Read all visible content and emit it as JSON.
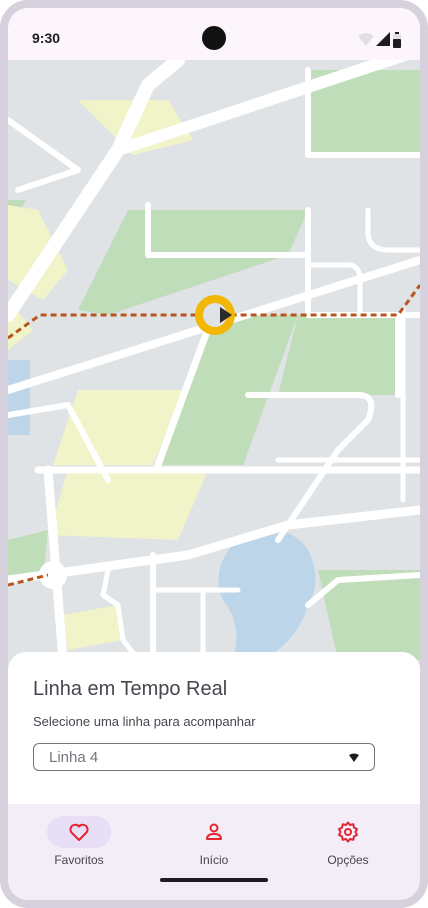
{
  "status_bar": {
    "time": "9:30",
    "icons": [
      "wifi-icon",
      "signal-icon",
      "battery-icon"
    ]
  },
  "map": {
    "route_color": "#b8541c",
    "bus_marker_color": "#f2b705",
    "park_color": "#bfddb8",
    "zone_color": "#f1f3c8",
    "water_color": "#bdd5e8"
  },
  "sheet": {
    "title": "Linha em Tempo Real",
    "subtitle": "Selecione uma linha para acompanhar",
    "select": {
      "value": "Linha 4"
    }
  },
  "nav": {
    "items": [
      {
        "label": "Favoritos",
        "icon": "heart-icon",
        "active": true
      },
      {
        "label": "Início",
        "icon": "person-icon",
        "active": false
      },
      {
        "label": "Opções",
        "icon": "gear-icon",
        "active": false
      }
    ],
    "accent_color": "#e4252f"
  }
}
